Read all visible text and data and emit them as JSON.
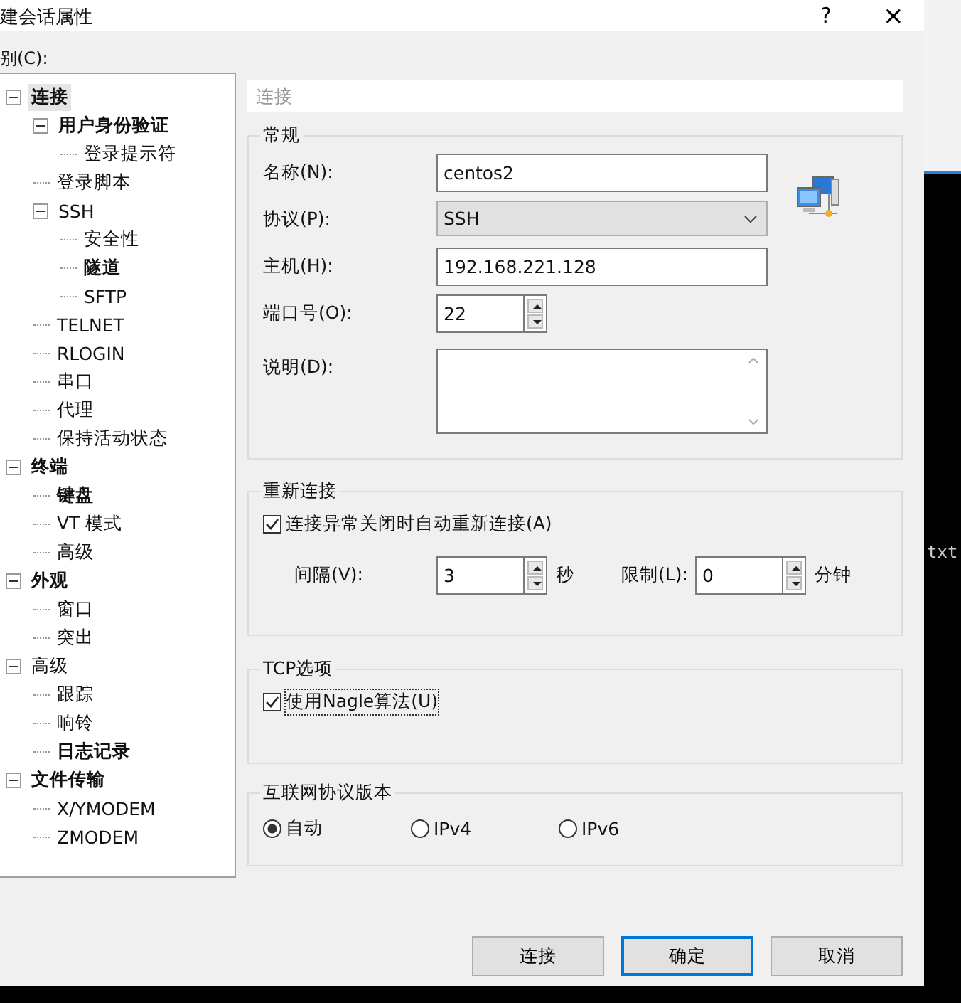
{
  "window": {
    "title": "建会话属性",
    "help": "?",
    "close": "×"
  },
  "category_label": "别(C):",
  "tree": [
    {
      "label": "连接",
      "bold": true,
      "selected": true,
      "expanded": true,
      "children": [
        {
          "label": "用户身份验证",
          "bold": true,
          "selected": false,
          "expanded": true,
          "children": [
            {
              "label": "登录提示符",
              "bold": false,
              "selected": false
            }
          ]
        },
        {
          "label": "登录脚本",
          "bold": false,
          "selected": false
        },
        {
          "label": "SSH",
          "bold": false,
          "selected": false,
          "expanded": true,
          "children": [
            {
              "label": "安全性",
              "bold": false,
              "selected": false
            },
            {
              "label": "隧道",
              "bold": true,
              "selected": false
            },
            {
              "label": "SFTP",
              "bold": false,
              "selected": false
            }
          ]
        },
        {
          "label": "TELNET",
          "bold": false,
          "selected": false
        },
        {
          "label": "RLOGIN",
          "bold": false,
          "selected": false
        },
        {
          "label": "串口",
          "bold": false,
          "selected": false
        },
        {
          "label": "代理",
          "bold": false,
          "selected": false
        },
        {
          "label": "保持活动状态",
          "bold": false,
          "selected": false
        }
      ]
    },
    {
      "label": "终端",
      "bold": true,
      "selected": false,
      "expanded": true,
      "children": [
        {
          "label": "键盘",
          "bold": true,
          "selected": false
        },
        {
          "label": "VT 模式",
          "bold": false,
          "selected": false
        },
        {
          "label": "高级",
          "bold": false,
          "selected": false
        }
      ]
    },
    {
      "label": "外观",
      "bold": true,
      "selected": false,
      "expanded": true,
      "children": [
        {
          "label": "窗口",
          "bold": false,
          "selected": false
        },
        {
          "label": "突出",
          "bold": false,
          "selected": false
        }
      ]
    },
    {
      "label": "高级",
      "bold": false,
      "selected": false,
      "expanded": true,
      "children": [
        {
          "label": "跟踪",
          "bold": false,
          "selected": false
        },
        {
          "label": "响铃",
          "bold": false,
          "selected": false
        },
        {
          "label": "日志记录",
          "bold": true,
          "selected": false
        }
      ]
    },
    {
      "label": "文件传输",
      "bold": true,
      "selected": false,
      "expanded": true,
      "children": [
        {
          "label": "X/YMODEM",
          "bold": false,
          "selected": false
        },
        {
          "label": "ZMODEM",
          "bold": false,
          "selected": false
        }
      ]
    }
  ],
  "path_header": "连接",
  "general": {
    "title": "常规",
    "fields": [
      {
        "kind": "text",
        "label": "名称(N):",
        "value": "centos2"
      },
      {
        "kind": "select",
        "label": "协议(P):",
        "value": "SSH"
      },
      {
        "kind": "text",
        "label": "主机(H):",
        "value": "192.168.221.128"
      },
      {
        "kind": "spin",
        "label": "端口号(O):",
        "value": "22"
      },
      {
        "kind": "textarea",
        "label": "说明(D):"
      }
    ]
  },
  "reconnect": {
    "title": "重新连接",
    "checkbox": {
      "label": "连接异常关闭时自动重新连接(A)",
      "checked": true
    },
    "interval": {
      "label": "间隔(V):",
      "value": "3",
      "unit": "秒"
    },
    "limit": {
      "label": "限制(L):",
      "value": "0",
      "unit": "分钟"
    }
  },
  "tcp": {
    "title": "TCP选项",
    "checkbox": {
      "label": "使用Nagle算法(U)",
      "checked": true,
      "focused": true
    }
  },
  "ip_version": {
    "title": "互联网协议版本",
    "options": [
      {
        "label": "自动",
        "selected": true
      },
      {
        "label": "IPv4",
        "selected": false
      },
      {
        "label": "IPv6",
        "selected": false
      }
    ]
  },
  "buttons": [
    {
      "label": "连接",
      "default": false
    },
    {
      "label": "确定",
      "default": true
    },
    {
      "label": "取消",
      "default": false
    }
  ],
  "background": {
    "text": "txt"
  }
}
